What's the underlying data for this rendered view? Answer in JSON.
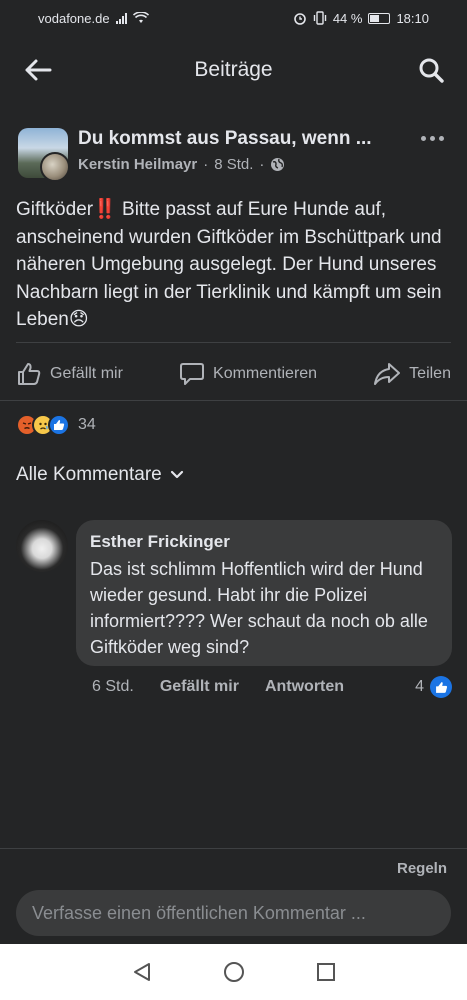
{
  "status_bar": {
    "carrier": "vodafone.de",
    "battery": "44 %",
    "time": "18:10"
  },
  "header": {
    "title": "Beiträge"
  },
  "post": {
    "group_name": "Du kommst aus Passau, wenn ...",
    "author": "Kerstin Heilmayr",
    "separator": "·",
    "time": "8 Std.",
    "text": "Giftköder‼️ Bitte passt auf Eure Hunde auf, anscheinend wurden Giftköder im Bschüttpark und näheren Umgebung ausgelegt. Der Hund unseres Nachbarn liegt in der Tierklinik und kämpft um sein Leben😞"
  },
  "actions": {
    "like": "Gefällt mir",
    "comment": "Kommentieren",
    "share": "Teilen"
  },
  "reactions": {
    "icons": [
      "angry-reaction",
      "sad-reaction",
      "like-reaction"
    ],
    "count": "34"
  },
  "comments_filter": {
    "label": "Alle Kommentare"
  },
  "comment": {
    "author": "Esther Frickinger",
    "text": "Das ist schlimm Hoffentlich wird der Hund wieder gesund. Habt ihr die Polizei informiert???? Wer schaut da noch ob alle Giftköder weg sind?",
    "time": "6 Std.",
    "like_label": "Gefällt mir",
    "reply_label": "Antworten",
    "like_count": "4"
  },
  "footer": {
    "rules_label": "Regeln",
    "composer_placeholder": "Verfasse einen öffentlichen Kommentar ..."
  },
  "colors": {
    "background": "#242526",
    "bubble": "#3a3b3c",
    "like_blue": "#1b74e4"
  }
}
